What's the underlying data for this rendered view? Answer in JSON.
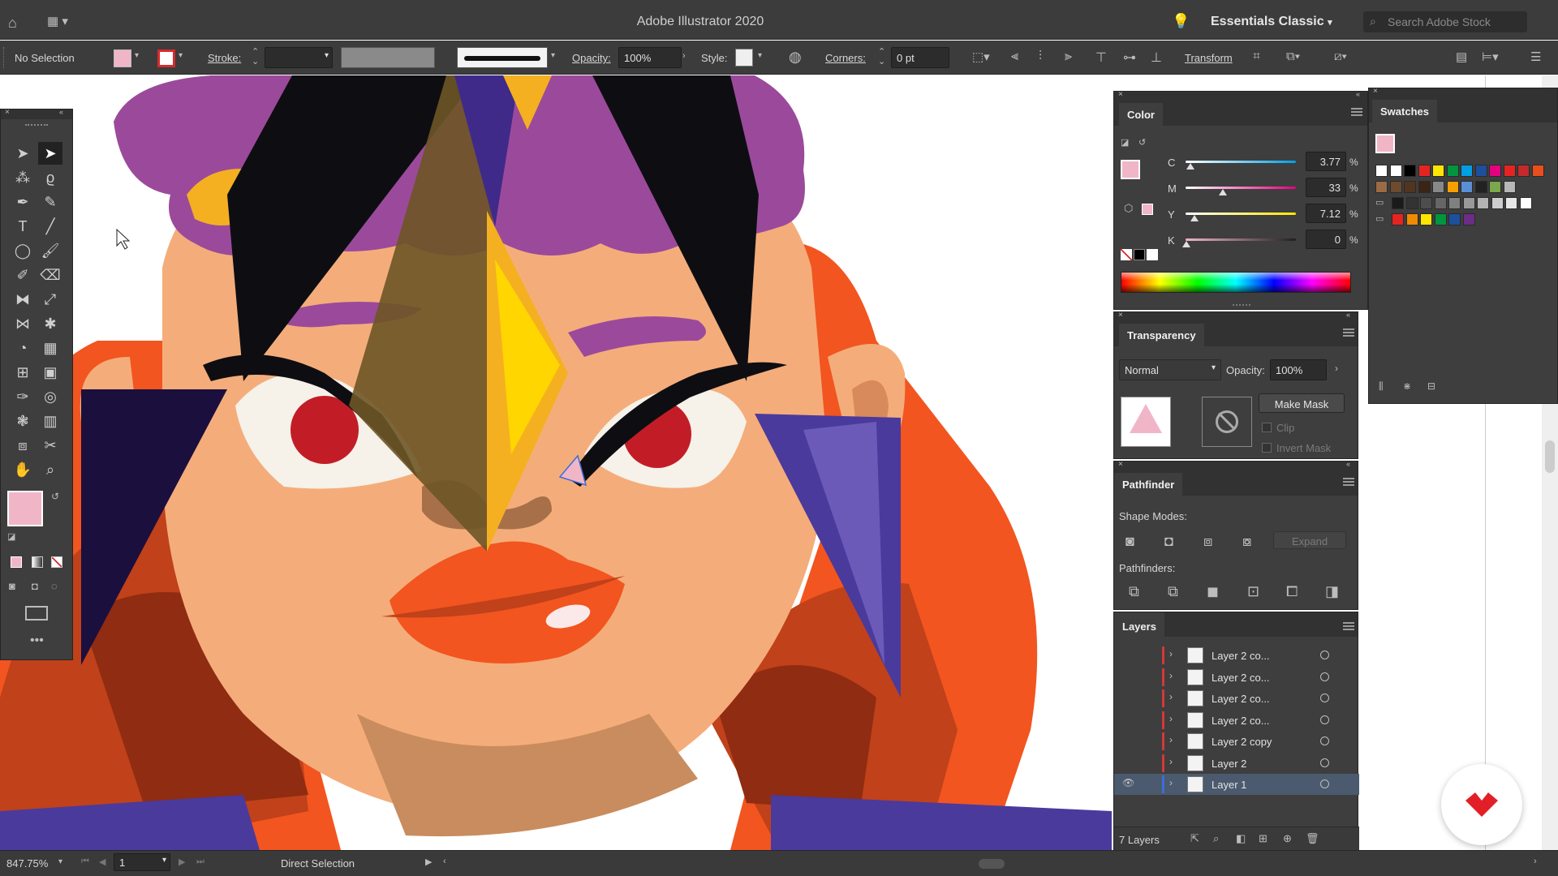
{
  "app": {
    "title": "Adobe Illustrator 2020",
    "workspace": "Essentials Classic",
    "search_placeholder": "Search Adobe Stock"
  },
  "control_bar": {
    "selection": "No Selection",
    "stroke_label": "Stroke:",
    "opacity_label": "Opacity:",
    "opacity_value": "100%",
    "style_label": "Style:",
    "corners_label": "Corners:",
    "corners_value": "0 pt",
    "transform_label": "Transform"
  },
  "color_panel": {
    "title": "Color",
    "channels": [
      {
        "label": "C",
        "value": "3.77",
        "unit": "%",
        "level": 0.04,
        "gradient": "linear-gradient(90deg,#ffffff,#00a0e6)"
      },
      {
        "label": "M",
        "value": "33",
        "unit": "%",
        "level": 0.33,
        "gradient": "linear-gradient(90deg,#ffffff,#e4007e)"
      },
      {
        "label": "Y",
        "value": "7.12",
        "unit": "%",
        "level": 0.07,
        "gradient": "linear-gradient(90deg,#ffffff,#ffe600)"
      },
      {
        "label": "K",
        "value": "0",
        "unit": "%",
        "level": 0.0,
        "gradient": "linear-gradient(90deg,#f0b6c8,#231f20)"
      }
    ],
    "fill_color": "#f0b6c8"
  },
  "swatches_panel": {
    "title": "Swatches",
    "row1": [
      "#ffffff",
      "#ffffff",
      "#000000",
      "#e52421",
      "#ffe600",
      "#00963f",
      "#009fe3",
      "#1d4f9c",
      "#e4007e",
      "#e52421",
      "#c32a2a",
      "#e94e1b"
    ],
    "row2": [
      "#9b6b45",
      "#6e4a2e",
      "#53341e",
      "#3b2416",
      "#888888",
      "#f5a000",
      "#5a8fd6",
      "#222222",
      "#7aa84a",
      "#b7b7b7"
    ],
    "row3": [
      "#1a1a1a",
      "#333333",
      "#4d4d4d",
      "#666666",
      "#808080",
      "#999999",
      "#b3b3b3",
      "#cccccc",
      "#e6e6e6",
      "#ffffff"
    ],
    "row4": [
      "#e52421",
      "#f08a00",
      "#ffe600",
      "#00963f",
      "#1d4f9c",
      "#6b2d86"
    ]
  },
  "transparency_panel": {
    "title": "Transparency",
    "blend_mode": "Normal",
    "opacity_label": "Opacity:",
    "opacity_value": "100%",
    "make_mask": "Make Mask",
    "clip": "Clip",
    "invert_mask": "Invert Mask"
  },
  "pathfinder_panel": {
    "title": "Pathfinder",
    "shape_modes": "Shape Modes:",
    "expand": "Expand",
    "pathfinders": "Pathfinders:"
  },
  "layers_panel": {
    "title": "Layers",
    "layers": [
      {
        "name": "Layer 2 co...",
        "visible": false,
        "selected": false
      },
      {
        "name": "Layer 2 co...",
        "visible": false,
        "selected": false
      },
      {
        "name": "Layer 2 co...",
        "visible": false,
        "selected": false
      },
      {
        "name": "Layer 2 co...",
        "visible": false,
        "selected": false
      },
      {
        "name": "Layer 2 copy",
        "visible": false,
        "selected": false
      },
      {
        "name": "Layer 2",
        "visible": false,
        "selected": false
      },
      {
        "name": "Layer 1",
        "visible": true,
        "selected": true
      }
    ],
    "count": "7 Layers"
  },
  "status_bar": {
    "zoom": "847.75%",
    "artboard": "1",
    "tool": "Direct Selection"
  },
  "colors": {
    "fill": "#f0b6c8",
    "selection_row": "#4b5a6e",
    "layer_color": "#d43838"
  }
}
